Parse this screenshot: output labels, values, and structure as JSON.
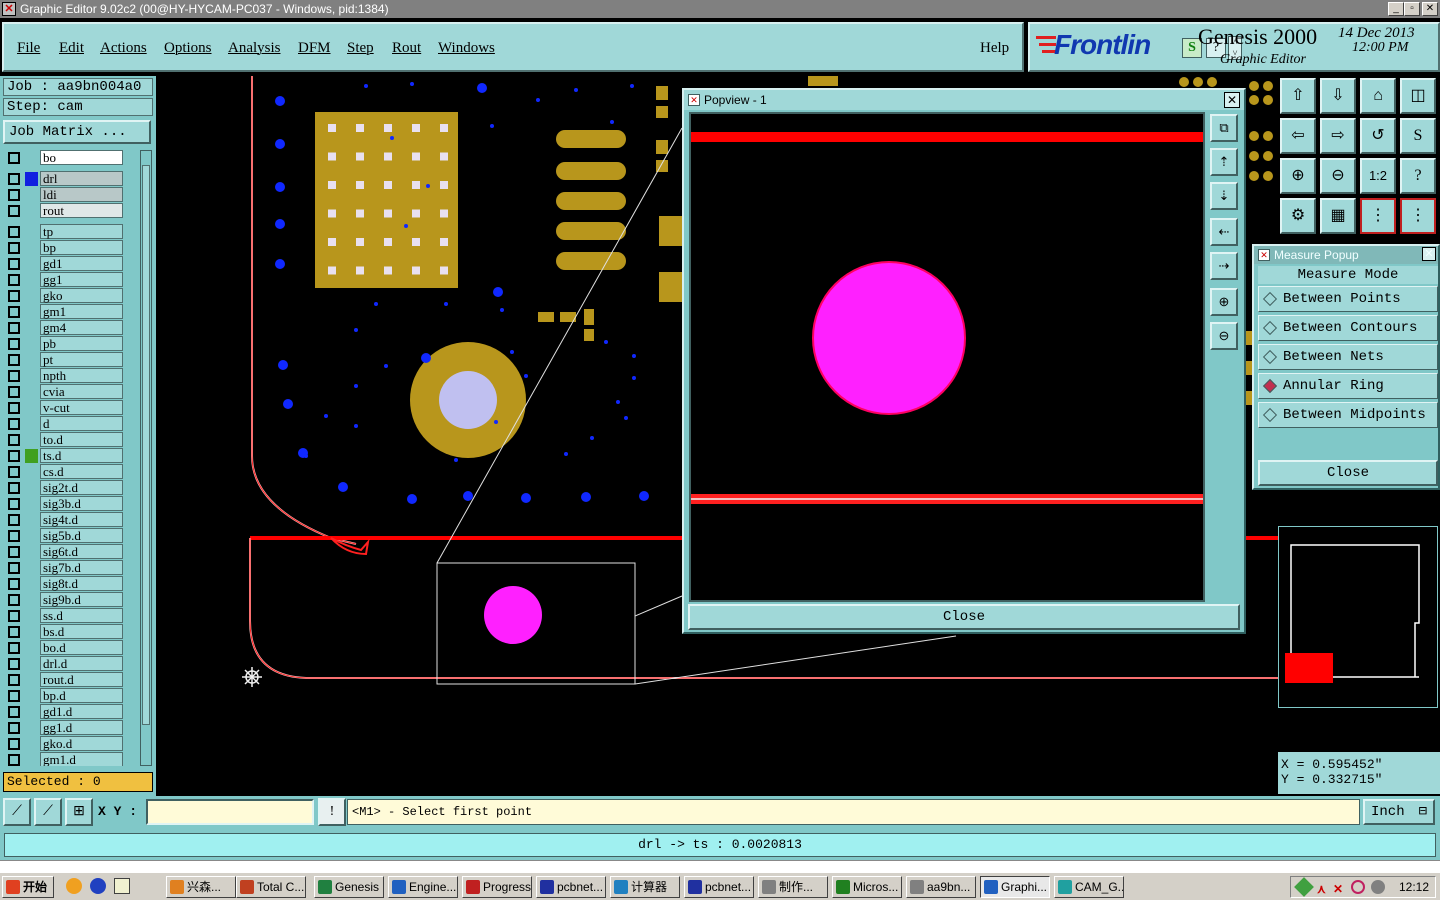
{
  "window": {
    "title": "Graphic Editor 9.02c2 (00@HY-HYCAM-PC037 - Windows, pid:1384)"
  },
  "menu": {
    "items": [
      "File",
      "Edit",
      "Actions",
      "Options",
      "Analysis",
      "DFM",
      "Step",
      "Rout",
      "Windows"
    ],
    "help": "Help"
  },
  "brand": {
    "logo": "Frontlin",
    "product": "Genesis 2000",
    "subtitle": "Graphic Editor",
    "date": "14 Dec 2013",
    "time": "12:00 PM",
    "s_badge": "S",
    "q_badge": "?"
  },
  "job": {
    "job_label": "Job  : aa9bn004a0",
    "step_label": "Step: cam",
    "matrix_button": "Job Matrix ..."
  },
  "layers": [
    {
      "name": "bo",
      "mark": "",
      "style": "white"
    },
    {
      "name": "drl",
      "mark": "#1020e0",
      "style": "gray"
    },
    {
      "name": "ldi",
      "mark": "",
      "style": "gray"
    },
    {
      "name": "rout",
      "mark": "",
      "style": "light"
    },
    {
      "name": "tp",
      "mark": ""
    },
    {
      "name": "bp",
      "mark": ""
    },
    {
      "name": "gd1",
      "mark": ""
    },
    {
      "name": "gg1",
      "mark": ""
    },
    {
      "name": "gko",
      "mark": ""
    },
    {
      "name": "gm1",
      "mark": ""
    },
    {
      "name": "gm4",
      "mark": ""
    },
    {
      "name": "pb",
      "mark": ""
    },
    {
      "name": "pt",
      "mark": ""
    },
    {
      "name": "npth",
      "mark": ""
    },
    {
      "name": "cvia",
      "mark": ""
    },
    {
      "name": "v-cut",
      "mark": ""
    },
    {
      "name": "d",
      "mark": ""
    },
    {
      "name": "to.d",
      "mark": ""
    },
    {
      "name": "ts.d",
      "mark": "#40a020"
    },
    {
      "name": "cs.d",
      "mark": ""
    },
    {
      "name": "sig2t.d",
      "mark": ""
    },
    {
      "name": "sig3b.d",
      "mark": ""
    },
    {
      "name": "sig4t.d",
      "mark": ""
    },
    {
      "name": "sig5b.d",
      "mark": ""
    },
    {
      "name": "sig6t.d",
      "mark": ""
    },
    {
      "name": "sig7b.d",
      "mark": ""
    },
    {
      "name": "sig8t.d",
      "mark": ""
    },
    {
      "name": "sig9b.d",
      "mark": ""
    },
    {
      "name": "ss.d",
      "mark": ""
    },
    {
      "name": "bs.d",
      "mark": ""
    },
    {
      "name": "bo.d",
      "mark": ""
    },
    {
      "name": "drl.d",
      "mark": ""
    },
    {
      "name": "rout.d",
      "mark": ""
    },
    {
      "name": "bp.d",
      "mark": ""
    },
    {
      "name": "gd1.d",
      "mark": ""
    },
    {
      "name": "gg1.d",
      "mark": ""
    },
    {
      "name": "gko.d",
      "mark": ""
    },
    {
      "name": "gm1.d",
      "mark": ""
    }
  ],
  "selected": "Selected : 0",
  "popview": {
    "title": "Popview - 1",
    "close": "Close"
  },
  "measure": {
    "title": "Measure Popup",
    "heading": "Measure Mode",
    "options": [
      {
        "label": "Between Points",
        "selected": false
      },
      {
        "label": "Between Contours",
        "selected": false
      },
      {
        "label": "Between Nets",
        "selected": false
      },
      {
        "label": "Annular Ring",
        "selected": true
      },
      {
        "label": "Between Midpoints",
        "selected": false
      }
    ],
    "close": "Close"
  },
  "coords": {
    "x": "X  = 0.595452\"",
    "y": "Y  = 0.332715\""
  },
  "cmd": {
    "xy_label": "X Y :",
    "xy_value": "",
    "prompt": "<M1> - Select first point",
    "unit": "Inch",
    "excl": "!"
  },
  "status": "drl -> ts : 0.0020813",
  "colors": {
    "panel": "#80c8c8",
    "button": "#a0d8d8",
    "pad": "#b8961c",
    "drill": "#ff20ff",
    "rout": "#ff0000",
    "via": "#1020e0"
  },
  "taskbar": {
    "start": "开始",
    "tasks": [
      "兴森...",
      "Total C...",
      "Genesis",
      "Engine...",
      "Progress",
      "pcbnet...",
      "计算器",
      "pcbnet...",
      "制作...",
      "Micros...",
      "aa9bn...",
      "Graphi...",
      "CAM_G..."
    ],
    "clock": "12:12"
  }
}
